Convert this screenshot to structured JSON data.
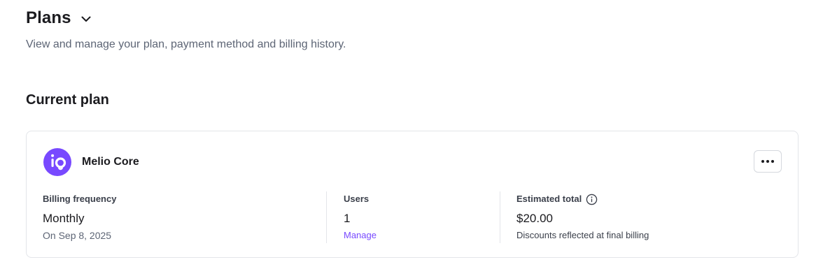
{
  "header": {
    "title": "Plans",
    "subtitle": "View and manage your plan, payment method and billing history."
  },
  "current_plan": {
    "section_title": "Current plan",
    "plan_name": "Melio Core",
    "billing_frequency": {
      "label": "Billing frequency",
      "value": "Monthly",
      "sub": "On Sep 8, 2025"
    },
    "users": {
      "label": "Users",
      "value": "1",
      "link": "Manage"
    },
    "estimated_total": {
      "label": "Estimated total",
      "value": "$20.00",
      "sub": "Discounts reflected at final billing"
    }
  },
  "icons": {
    "header_toggle": "chevron-down-icon",
    "logo": "melio-logo-icon",
    "more": "more-horizontal-icon",
    "info": "info-icon"
  },
  "colors": {
    "brand": "#7849ff",
    "text_primary": "#1b1b1f",
    "text_secondary": "#5d6575",
    "border": "#e3e5e9"
  }
}
